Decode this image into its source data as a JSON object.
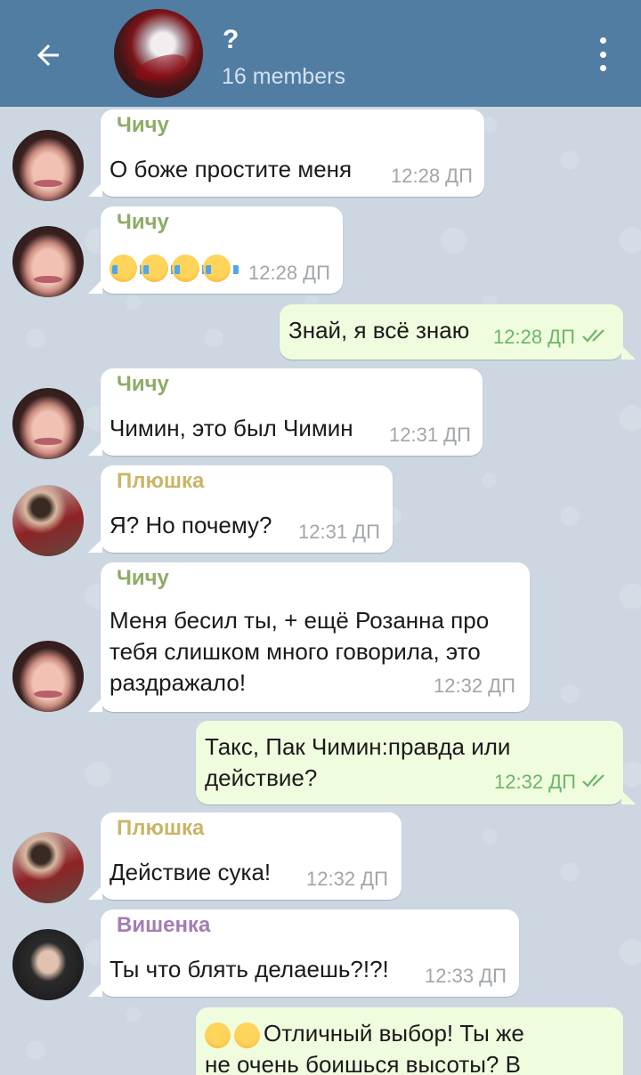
{
  "header": {
    "title": "?",
    "subtitle": "16 members",
    "back_icon": "arrow-left-icon",
    "menu_icon": "more-vertical-icon",
    "colors": {
      "bar": "#527da3",
      "subtitle": "#d2e2f0"
    }
  },
  "colors": {
    "incoming_bubble": "#ffffff",
    "outgoing_bubble": "#effdde",
    "sender_chichu": "#8fab68",
    "sender_plyushka": "#c9b567",
    "sender_vishenka": "#a47cb4",
    "time_in": "#a0a6aa",
    "time_out": "#6db46b"
  },
  "messages": [
    {
      "sender": "Чичу",
      "text": "О боже простите меня",
      "time": "12:28 ДП"
    },
    {
      "sender": "Чичу",
      "emoji": "loudly-crying-face x4",
      "time": "12:28 ДП"
    },
    {
      "text": "Знай, я всё знаю",
      "time": "12:28 ДП",
      "status": "read"
    },
    {
      "sender": "Чичу",
      "text": "Чимин, это был Чимин",
      "time": "12:31 ДП"
    },
    {
      "sender": "Плюшка",
      "text": "Я? Но почему?",
      "time": "12:31 ДП"
    },
    {
      "sender": "Чичу",
      "lines": [
        "Меня бесил ты, + ещё Розанна про",
        "тебя слишком много говорила, это",
        "раздражало!"
      ],
      "time": "12:32 ДП"
    },
    {
      "lines": [
        "Такс, Пак Чимин:правда или",
        "действие?"
      ],
      "time": "12:32 ДП",
      "status": "read"
    },
    {
      "sender": "Плюшка",
      "text": "Действие сука!",
      "time": "12:32 ДП"
    },
    {
      "sender": "Вишенка",
      "text": "Ты что блять делаешь?!?!",
      "time": "12:33 ДП"
    },
    {
      "emoji": "smirking-face, relieved-face",
      "lines": [
        "Отличный выбор! Ты же",
        "не очень боишься высоты? В"
      ]
    }
  ]
}
